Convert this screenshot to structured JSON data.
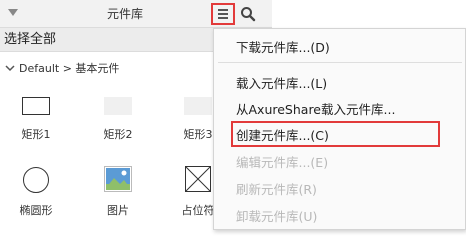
{
  "panel": {
    "title": "元件库",
    "select_all": "选择全部",
    "library_path": "Default > 基本元件",
    "widgets": [
      {
        "label": "矩形1",
        "icon": "rectangle-outline"
      },
      {
        "label": "矩形2",
        "icon": "rectangle-gray"
      },
      {
        "label": "矩形3",
        "icon": "rectangle-gray"
      },
      {
        "label": "椭圆形",
        "icon": "ellipse"
      },
      {
        "label": "图片",
        "icon": "image"
      },
      {
        "label": "占位符",
        "icon": "placeholder"
      }
    ]
  },
  "menu": {
    "items": [
      {
        "label": "下载元件库...(D)",
        "enabled": true
      },
      {
        "label": "载入元件库...(L)",
        "enabled": true
      },
      {
        "label": "从AxureShare载入元件库...",
        "enabled": true
      },
      {
        "label": "创建元件库...(C)",
        "enabled": true,
        "highlighted": true
      },
      {
        "label": "编辑元件库...(E)",
        "enabled": false
      },
      {
        "label": "刷新元件库(R)",
        "enabled": false
      },
      {
        "label": "卸载元件库(U)",
        "enabled": false
      }
    ]
  },
  "colors": {
    "highlight_border": "#e23a3a",
    "disabled_text": "#b8b8b8",
    "image_sky": "#5b9bd5"
  }
}
